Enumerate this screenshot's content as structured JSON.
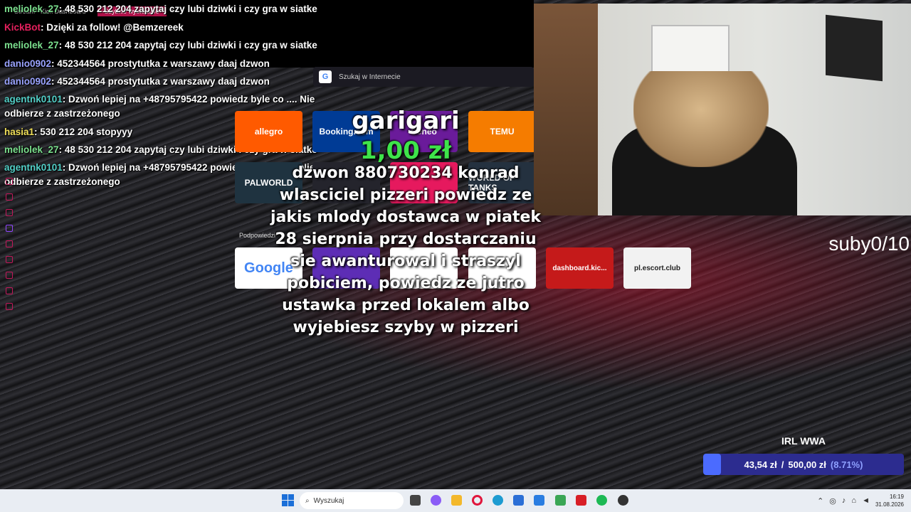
{
  "browser": {
    "tabs": [
      {
        "label": "Stream - Kick Dashboard",
        "active": false
      },
      {
        "label": "Szybkie wybieranie",
        "active": true
      }
    ],
    "new_tab": "+",
    "search_placeholder": "Szukaj w Internecie",
    "google_letter": "G",
    "speed_dial": [
      {
        "label": "allegro",
        "color": "#ff5a00"
      },
      {
        "label": "Booking.com",
        "color": "#003b95"
      },
      {
        "label": "Ceneo",
        "color": "#6a1b9a"
      },
      {
        "label": "TEMU",
        "color": "#f57c00"
      },
      {
        "label": "PALWORLD",
        "color": "#1f3340"
      },
      {
        "label": "",
        "color": "#24242c"
      },
      {
        "label": "",
        "color": "#e6195e"
      },
      {
        "label": "WORLD OF TANKS",
        "color": "#24313f"
      },
      {
        "label": "Google",
        "color": "#ffffff"
      },
      {
        "label": "",
        "color": "#5d2db5"
      },
      {
        "label": "",
        "color": "#ffffff"
      },
      {
        "label": "",
        "color": "#ffffff"
      },
      {
        "label": "dashboard.kic...",
        "color": "#c51a1a"
      },
      {
        "label": "pl.escort.club",
        "color": "#f2f2f2"
      }
    ],
    "hints_label": "Podpowiedzi"
  },
  "chat": [
    {
      "user": "meliolek_27",
      "color": "#7be08e",
      "msg": "48 530 212 204 zapytaj czy lubi dziwki i czy gra w siatke"
    },
    {
      "user": "KickBot",
      "color": "#e5205d",
      "msg": "Dzięki za follow! @Bemzereek"
    },
    {
      "user": "meliolek_27",
      "color": "#7be08e",
      "msg": "48 530 212 204 zapytaj czy lubi dziwki i czy gra w siatke"
    },
    {
      "user": "danio0902",
      "color": "#9aa3ff",
      "msg": "452344564 prostytutka z warszawy daaj dzwon"
    },
    {
      "user": "danio0902",
      "color": "#9aa3ff",
      "msg": "452344564 prostytutka z warszawy daaj dzwon"
    },
    {
      "user": "agentnk0101",
      "color": "#53d0c8",
      "msg": "Dzwoń lepiej na +48795795422 powiedz byle co .... Nie odbierze z zastrzeżonego"
    },
    {
      "user": "hasia1",
      "color": "#f1e05a",
      "msg": "530 212 204 stopyyy"
    },
    {
      "user": "meliolek_27",
      "color": "#7be08e",
      "msg": "48 530 212 204 zapytaj czy lubi dziwki i czy gra w siatke"
    },
    {
      "user": "agentnk0101",
      "color": "#53d0c8",
      "msg": "Dzwoń lepiej na +48795795422 powiedz byle co .... Nie odbierze z zastrzeżonego"
    }
  ],
  "donation": {
    "name": "garigari",
    "amount": "1,00 zł",
    "message": "dzwon 880730234 konrad wlasciciel pizzeri powiedz ze jakis mlody dostawca w piatek 28 sierpnia przy dostarczaniu sie awanturowal i straszyl pobiciem, powiedz ze jutro ustawka przed lokalem albo wyjebiesz szyby w pizzeri"
  },
  "sub_counter": "suby0/10",
  "goal": {
    "title": "IRL WWA",
    "current": "43,54 zł",
    "separator": "/",
    "target": "500,00 zł",
    "percent_label": "(8.71%)",
    "fraction": 0.0871,
    "bar_color": "#2c2c8f",
    "fill_color": "#4b6bff"
  },
  "taskbar": {
    "search_placeholder": "Wyszukaj",
    "time": "16:19",
    "date": "31.08.2026"
  }
}
